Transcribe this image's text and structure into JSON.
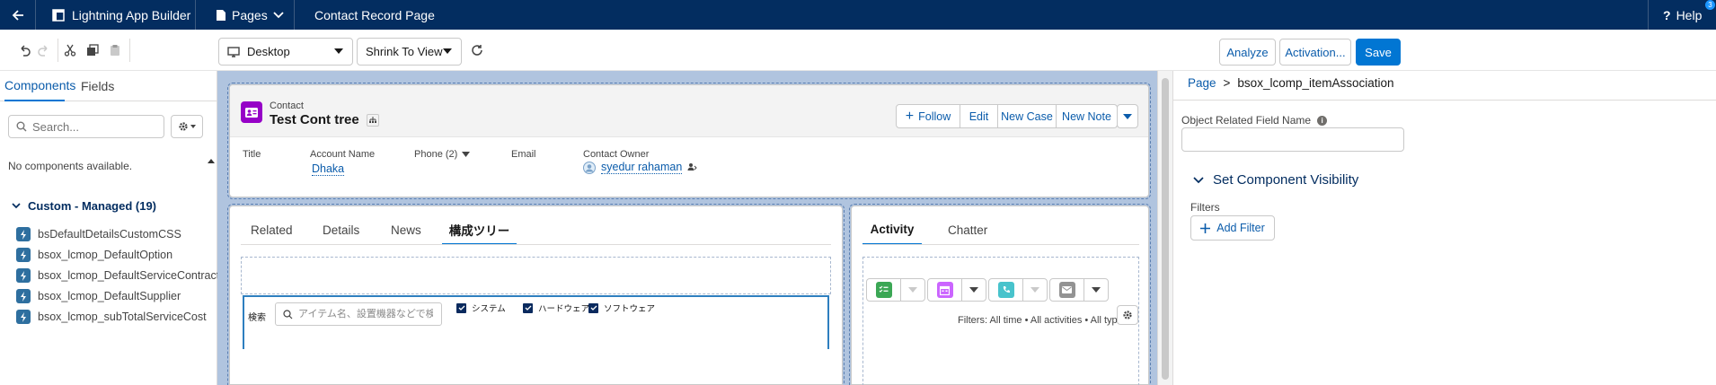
{
  "topbar": {
    "app_name": "Lightning App Builder",
    "pages_label": "Pages",
    "record_page": "Contact Record Page",
    "help_label": "Help",
    "help_badge": "3"
  },
  "toolbar": {
    "device": "Desktop",
    "view": "Shrink To View",
    "analyze": "Analyze",
    "activation": "Activation...",
    "save": "Save"
  },
  "left_panel": {
    "tabs": [
      "Components",
      "Fields"
    ],
    "search_placeholder": "Search...",
    "no_components": "No components available.",
    "section_title": "Custom - Managed (19)",
    "items": [
      "bsDefaultDetailsCustomCSS",
      "bsox_lcmop_DefaultOption",
      "bsox_lcmop_DefaultServiceContract",
      "bsox_lcmop_DefaultSupplier",
      "bsox_lcmop_subTotalServiceCost"
    ]
  },
  "record": {
    "object_label": "Contact",
    "name": "Test Cont tree",
    "actions": [
      "Follow",
      "Edit",
      "New Case",
      "New Note"
    ],
    "highlights": {
      "title_label": "Title",
      "account_label": "Account Name",
      "account_value": "Dhaka",
      "phone_label": "Phone (2)",
      "email_label": "Email",
      "owner_label": "Contact Owner",
      "owner_value": "syedur rahaman"
    },
    "tabs": [
      "Related",
      "Details",
      "News",
      "構成ツリー"
    ],
    "tree": {
      "search_label": "検索",
      "search_placeholder": "アイテム名、設置機器などで検索",
      "filters": [
        "システム",
        "ハードウェア",
        "ソフトウェア"
      ]
    },
    "activity_tabs": [
      "Activity",
      "Chatter"
    ],
    "activity_filter_text": "Filters: All time • All activities • All types"
  },
  "right_panel": {
    "breadcrumb_root": "Page",
    "breadcrumb_sep": ">",
    "breadcrumb_current": "bsox_lcomp_itemAssociation",
    "field_label": "Object Related Field Name",
    "field_value": "",
    "visibility_title": "Set Component Visibility",
    "filters_label": "Filters",
    "add_filter": "Add Filter"
  },
  "colors": {
    "topbar": "#032d60",
    "brand": "#0176d3",
    "canvas": "#b0c4df",
    "contact_icon": "#9602c7",
    "task": "#3ba755",
    "event": "#cb65ff",
    "call": "#48c3cc",
    "email": "#939393"
  }
}
